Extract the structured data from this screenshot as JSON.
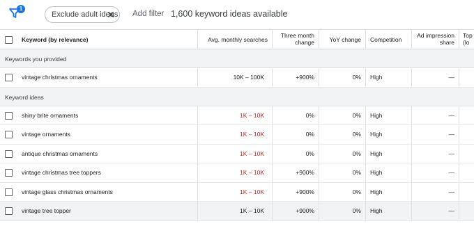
{
  "filter_bar": {
    "badge_count": "1",
    "chip_label": "Exclude adult ideas",
    "chip_close": "✕",
    "add_filter": "Add filter",
    "idea_count": "1,600 keyword ideas available"
  },
  "table": {
    "headers": {
      "keyword": "Keyword (by relevance)",
      "avg_searches": "Avg. monthly searches",
      "three_month_line1": "Three month",
      "three_month_line2": "change",
      "yoy": "YoY change",
      "competition": "Competition",
      "ad_impression_line1": "Ad impression",
      "ad_impression_line2": "share",
      "top_of_page_line1": "Top o",
      "top_of_page_line2": "(lo"
    },
    "section_provided": "Keywords you provided",
    "provided_rows": [
      {
        "keyword": "vintage christmas ornaments",
        "searches": "10K – 100K",
        "three_month": "+900%",
        "yoy": "0%",
        "competition": "High",
        "ad_share": "—"
      }
    ],
    "section_ideas": "Keyword ideas",
    "idea_rows": [
      {
        "keyword": "shiny brite ornaments",
        "searches": "1K – 10K",
        "three_month": "0%",
        "yoy": "0%",
        "competition": "High",
        "ad_share": "—"
      },
      {
        "keyword": "vintage ornaments",
        "searches": "1K – 10K",
        "three_month": "0%",
        "yoy": "0%",
        "competition": "High",
        "ad_share": "—"
      },
      {
        "keyword": "antique christmas ornaments",
        "searches": "1K – 10K",
        "three_month": "0%",
        "yoy": "0%",
        "competition": "High",
        "ad_share": "—"
      },
      {
        "keyword": "vintage christmas tree toppers",
        "searches": "1K – 10K",
        "three_month": "+900%",
        "yoy": "0%",
        "competition": "High",
        "ad_share": "—"
      },
      {
        "keyword": "vintage glass christmas ornaments",
        "searches": "1K – 10K",
        "three_month": "+900%",
        "yoy": "0%",
        "competition": "High",
        "ad_share": "—"
      },
      {
        "keyword": "vintage tree topper",
        "searches": "1K – 10K",
        "three_month": "+900%",
        "yoy": "0%",
        "competition": "High",
        "ad_share": "—"
      }
    ]
  },
  "colors": {
    "accent_blue": "#1a73e8",
    "range_red": "#c5221f",
    "section_bg": "#f1f3f4"
  },
  "icons": {
    "filter": "funnel-icon",
    "close": "close-icon",
    "checkbox": "checkbox-icon"
  }
}
